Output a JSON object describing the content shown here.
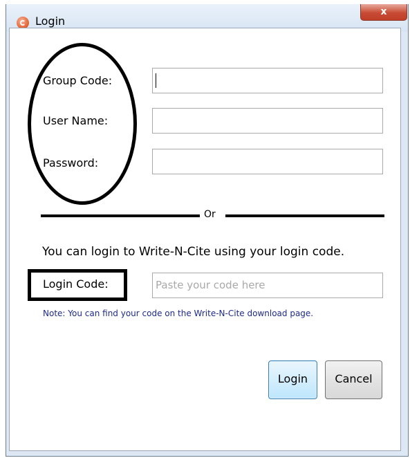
{
  "window": {
    "title": "Login",
    "close_symbol": "x"
  },
  "form": {
    "group_code": {
      "label": "Group Code:",
      "value": ""
    },
    "user_name": {
      "label": "User Name:",
      "value": ""
    },
    "password": {
      "label": "Password:",
      "value": ""
    }
  },
  "separator": {
    "label": "Or"
  },
  "login_code": {
    "intro": "You can login to Write-N-Cite using your login code.",
    "label": "Login Code:",
    "placeholder": "Paste your code here",
    "note": "Note: You can find your code on the Write-N-Cite download page."
  },
  "buttons": {
    "login": "Login",
    "cancel": "Cancel"
  }
}
